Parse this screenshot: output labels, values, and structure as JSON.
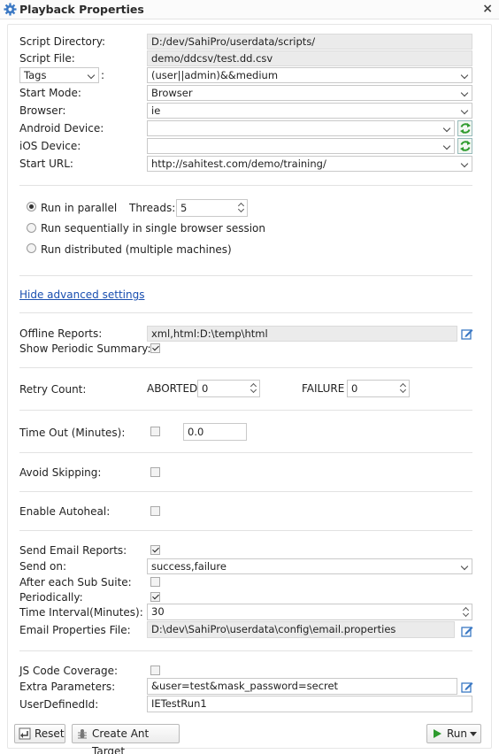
{
  "window": {
    "title": "Playback Properties",
    "close": "×"
  },
  "form": {
    "script_directory": {
      "label": "Script Directory:",
      "value": "D:/dev/SahiPro/userdata/scripts/"
    },
    "script_file": {
      "label": "Script File:",
      "value": "demo/ddcsv/test.dd.csv"
    },
    "tags": {
      "type_value": "Tags",
      "separator": ":",
      "value": "(user||admin)&&medium"
    },
    "start_mode": {
      "label": "Start Mode:",
      "value": "Browser"
    },
    "browser": {
      "label": "Browser:",
      "value": "ie"
    },
    "android_device": {
      "label": "Android Device:",
      "value": ""
    },
    "ios_device": {
      "label": "iOS Device:",
      "value": ""
    },
    "start_url": {
      "label": "Start URL:",
      "value": "http://sahitest.com/demo/training/"
    }
  },
  "run_mode": {
    "parallel": "Run in parallel",
    "threads_label": "Threads:",
    "threads_value": "5",
    "sequential": "Run sequentially in single browser session",
    "distributed": "Run distributed (multiple machines)",
    "selected": "parallel"
  },
  "advanced_link": "Hide advanced settings",
  "reports": {
    "offline_label": "Offline Reports:",
    "offline_value": "xml,html:D:\\temp\\html",
    "periodic_summary_label": "Show Periodic Summary:",
    "periodic_summary_checked": true
  },
  "retry": {
    "label": "Retry Count:",
    "aborted_label": "ABORTED",
    "aborted_value": "0",
    "failure_label": "FAILURE",
    "failure_value": "0"
  },
  "timeout": {
    "label": "Time Out (Minutes):",
    "checked": false,
    "value": "0.0"
  },
  "avoid_skipping": {
    "label": "Avoid Skipping:",
    "checked": false
  },
  "autoheal": {
    "label": "Enable Autoheal:",
    "checked": false
  },
  "email": {
    "send_label": "Send Email Reports:",
    "send_checked": true,
    "send_on_label": "Send on:",
    "send_on_value": "success,failure",
    "sub_suite_label": "After each Sub Suite:",
    "sub_suite_checked": false,
    "periodically_label": "Periodically:",
    "periodically_checked": true,
    "interval_label": "Time Interval(Minutes):",
    "interval_value": "30",
    "properties_label": "Email Properties File:",
    "properties_value": "D:\\dev\\SahiPro\\userdata\\config\\email.properties"
  },
  "extra": {
    "coverage_label": "JS Code Coverage:",
    "coverage_checked": false,
    "params_label": "Extra Parameters:",
    "params_value": "&user=test&mask_password=secret",
    "user_id_label": "UserDefinedId:",
    "user_id_value": "IETestRun1"
  },
  "buttons": {
    "reset": "Reset",
    "ant": "Create Ant Target",
    "run": "Run"
  },
  "colors": {
    "link": "#1a4fb0",
    "run_green": "#2e9b2e",
    "accent": "#3a78c4"
  }
}
